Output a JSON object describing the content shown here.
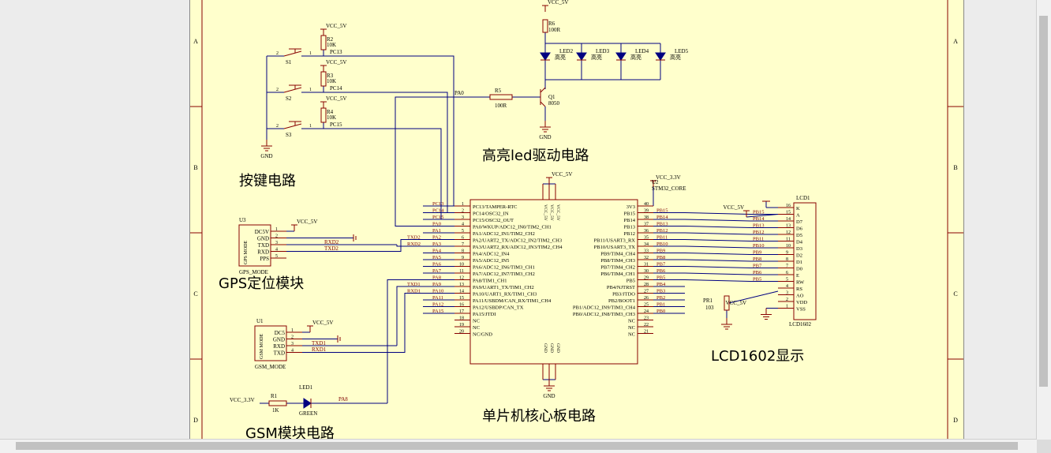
{
  "sections": {
    "button_circuit": "按键电路",
    "led_driver": "高亮led驱动电路",
    "gps": "GPS定位模块",
    "gsm": "GSM模块电路",
    "mcu": "单片机核心板电路",
    "lcd": "LCD1602显示"
  },
  "border_rows": [
    "A",
    "B",
    "C",
    "D"
  ],
  "power": {
    "vcc5": "VCC_5V",
    "vcc33": "VCC_3.3V",
    "gnd": "GND"
  },
  "buttons": [
    {
      "sw": "S1",
      "res": "R2",
      "val": "10K",
      "net": "PC13"
    },
    {
      "sw": "S2",
      "res": "R3",
      "val": "10K",
      "net": "PC14"
    },
    {
      "sw": "S3",
      "res": "R4",
      "val": "10K",
      "net": "PC15"
    }
  ],
  "led_driver": {
    "r6": "R6",
    "r6_val": "100R",
    "r5": "R5",
    "r5_val": "100R",
    "q1": "Q1",
    "q1_type": "8050",
    "net": "PA0",
    "leds": [
      {
        "ref": "LED2",
        "label": "高亮"
      },
      {
        "ref": "LED3",
        "label": "高亮"
      },
      {
        "ref": "LED4",
        "label": "高亮"
      },
      {
        "ref": "LED5",
        "label": "高亮"
      }
    ]
  },
  "gps": {
    "ref": "U3",
    "body": "GPS MODE",
    "name": "GPS_MODE",
    "pins": [
      "DC5V",
      "GND",
      "TXD",
      "RXD",
      "PPS"
    ],
    "nets": [
      "RXD2",
      "TXD2"
    ]
  },
  "gsm": {
    "ref": "U1",
    "body": "GSM MODE",
    "name": "GSM_MODE",
    "pins": [
      "DC5",
      "GND",
      "RXD",
      "TXD"
    ],
    "nets": [
      "TXD1",
      "RXD1"
    ]
  },
  "status_led": {
    "r": "R1",
    "r_val": "1K",
    "led": "LED1",
    "color": "GREEN",
    "net": "PA8"
  },
  "mcu": {
    "ref": "U2",
    "name": "STM32_CORE",
    "left_pins": [
      {
        "n": "1",
        "f": "PC13/TAMPER-RTC",
        "net": "PC13"
      },
      {
        "n": "2",
        "f": "PC14/OSC32_IN",
        "net": "PC14"
      },
      {
        "n": "3",
        "f": "PC15/OSC32_OUT",
        "net": "PC15"
      },
      {
        "n": "4",
        "f": "PA0/WKUP/ADC12_IN0/TIM2_CH1",
        "net": "PA0"
      },
      {
        "n": "5",
        "f": "PA1/ADC12_IN1/TIM2_CH2",
        "net": "PA1"
      },
      {
        "n": "6",
        "f": "PA2/UART2_TX/ADC12_IN2/TIM2_CH3",
        "net": "PA2"
      },
      {
        "n": "7",
        "f": "PA3/UART2_RX/ADC12_IN3/TIM2_CH4",
        "net": "PA3"
      },
      {
        "n": "8",
        "f": "PA4/ADC12_IN4",
        "net": "PA4"
      },
      {
        "n": "9",
        "f": "PA5/ADC12_IN5",
        "net": "PA5"
      },
      {
        "n": "10",
        "f": "PA6/ADC12_IN6/TIM3_CH1",
        "net": "PA6"
      },
      {
        "n": "11",
        "f": "PA7/ADC12_IN7/TIM3_CH2",
        "net": "PA7"
      },
      {
        "n": "12",
        "f": "PA8/TIM1_CH1",
        "net": "PA8"
      },
      {
        "n": "13",
        "f": "PA9/UART1_TX/TIM1_CH2",
        "net": "PA9"
      },
      {
        "n": "14",
        "f": "PA10/UART1_RX/TIM1_CH3",
        "net": "PA10"
      },
      {
        "n": "15",
        "f": "PA11/USBDM/CAN_RX/TIM1_CH4",
        "net": "PA11"
      },
      {
        "n": "16",
        "f": "PA12/USBDP/CAN_TX",
        "net": "PA12"
      },
      {
        "n": "17",
        "f": "PA15/JTDI",
        "net": "PA15"
      },
      {
        "n": "18",
        "f": "NC",
        "net": ""
      },
      {
        "n": "19",
        "f": "NC",
        "net": ""
      },
      {
        "n": "20",
        "f": "NC/GND",
        "net": ""
      }
    ],
    "right_pins": [
      {
        "n": "40",
        "f": "3V3",
        "net": ""
      },
      {
        "n": "39",
        "f": "PB15",
        "net": "PB15"
      },
      {
        "n": "38",
        "f": "PB14",
        "net": "PB14"
      },
      {
        "n": "37",
        "f": "PB13",
        "net": "PB13"
      },
      {
        "n": "36",
        "f": "PB12",
        "net": "PB12"
      },
      {
        "n": "35",
        "f": "PB11/USART3_RX",
        "net": "PB11"
      },
      {
        "n": "34",
        "f": "PB10/USART3_TX",
        "net": "PB10"
      },
      {
        "n": "33",
        "f": "PB9/TIM4_CH4",
        "net": "PB9"
      },
      {
        "n": "32",
        "f": "PB8/TIM4_CH3",
        "net": "PB8"
      },
      {
        "n": "31",
        "f": "PB7/TIM4_CH2",
        "net": "PB7"
      },
      {
        "n": "30",
        "f": "PB6/TIM4_CH1",
        "net": "PB6"
      },
      {
        "n": "29",
        "f": "PB5",
        "net": "PB5"
      },
      {
        "n": "28",
        "f": "PB4/NJTRST",
        "net": "PB4"
      },
      {
        "n": "27",
        "f": "PB3/JTDO",
        "net": "PB3"
      },
      {
        "n": "26",
        "f": "PB2/BOOT1",
        "net": "PB2"
      },
      {
        "n": "25",
        "f": "PB1/ADC12_IN9/TIM3_CH4",
        "net": "PB1"
      },
      {
        "n": "24",
        "f": "PB0/ADC12_IN8/TIM3_CH3",
        "net": "PB0"
      },
      {
        "n": "23",
        "f": "NC",
        "net": ""
      },
      {
        "n": "22",
        "f": "NC",
        "net": ""
      },
      {
        "n": "21",
        "f": "NC",
        "net": ""
      }
    ],
    "top_pins": [
      "VCC_5V",
      "VCC_5V",
      "VCC_5V"
    ],
    "bottom_pins": [
      "GND",
      "GND",
      "GND"
    ]
  },
  "lcd": {
    "ref": "LCD1",
    "name": "LCD1602",
    "pr": "PR1",
    "pr_val": "103",
    "pins": [
      {
        "n": "16",
        "f": "K",
        "net": ""
      },
      {
        "n": "15",
        "f": "A",
        "net": "PB15"
      },
      {
        "n": "14",
        "f": "D7",
        "net": "PB14"
      },
      {
        "n": "13",
        "f": "D6",
        "net": "PB13"
      },
      {
        "n": "12",
        "f": "D5",
        "net": "PB12"
      },
      {
        "n": "11",
        "f": "D4",
        "net": "PB11"
      },
      {
        "n": "10",
        "f": "D3",
        "net": "PB10"
      },
      {
        "n": "9",
        "f": "D2",
        "net": "PB9"
      },
      {
        "n": "8",
        "f": "D1",
        "net": "PB8"
      },
      {
        "n": "7",
        "f": "D0",
        "net": "PB7"
      },
      {
        "n": "6",
        "f": "E",
        "net": "PB6"
      },
      {
        "n": "5",
        "f": "RW",
        "net": "PB5"
      },
      {
        "n": "4",
        "f": "RS",
        "net": ""
      },
      {
        "n": "3",
        "f": "AO",
        "net": ""
      },
      {
        "n": "2",
        "f": "VDD",
        "net": ""
      },
      {
        "n": "1",
        "f": "VSS",
        "net": ""
      }
    ]
  }
}
